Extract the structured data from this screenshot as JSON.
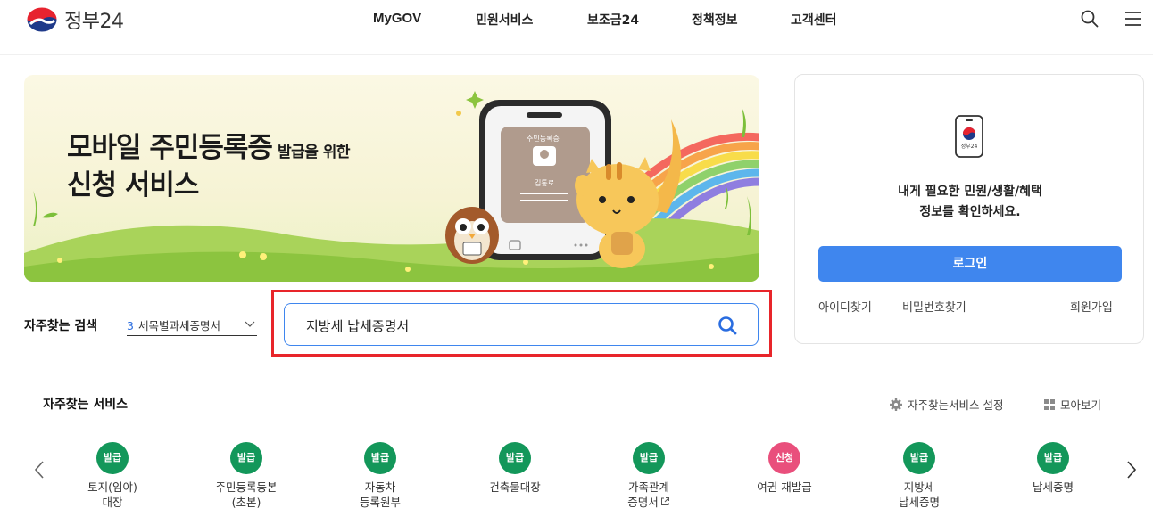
{
  "header": {
    "logo_text": "정부24",
    "nav": [
      "MyGOV",
      "민원서비스",
      "보조금24",
      "정책정보",
      "고객센터"
    ],
    "search_icon": "search-icon",
    "menu_icon": "hamburger-menu-icon"
  },
  "banner": {
    "title_main": "모바일 주민등록증",
    "title_small": "발급을 위한",
    "title_line2": "신청 서비스",
    "card_title": "주민등록증",
    "card_name": "김통로"
  },
  "login": {
    "icon_label": "정부24",
    "message_line1": "내게 필요한 민원/생활/혜택",
    "message_line2": "정보를 확인하세요.",
    "login_button": "로그인",
    "find_id": "아이디찾기",
    "find_password": "비밀번호찾기",
    "signup": "회원가입"
  },
  "frequent_search": {
    "label": "자주찾는 검색",
    "selected_rank": "3",
    "selected_term": "세목별과세증명서",
    "search_value": "지방세 납세증명서"
  },
  "services": {
    "title": "자주찾는 서비스",
    "settings_label": "자주찾는서비스 설정",
    "grid_label": "모아보기",
    "items": [
      {
        "badge": "발급",
        "line1": "토지(임야)",
        "line2": "대장",
        "badge_color": "#13975a"
      },
      {
        "badge": "발급",
        "line1": "주민등록등본",
        "line2": "(초본)",
        "badge_color": "#13975a"
      },
      {
        "badge": "발급",
        "line1": "자동차",
        "line2": "등록원부",
        "badge_color": "#13975a"
      },
      {
        "badge": "발급",
        "line1": "건축물대장",
        "line2": "",
        "badge_color": "#13975a"
      },
      {
        "badge": "발급",
        "line1": "가족관계",
        "line2": "증명서",
        "badge_color": "#13975a"
      },
      {
        "badge": "신청",
        "line1": "여권 재발급",
        "line2": "",
        "badge_color": "#e94f7c"
      },
      {
        "badge": "발급",
        "line1": "지방세",
        "line2": "납세증명",
        "badge_color": "#13975a"
      },
      {
        "badge": "발급",
        "line1": "납세증명",
        "line2": "",
        "badge_color": "#13975a"
      }
    ]
  },
  "colors": {
    "accent_blue": "#3f86ee",
    "highlight_red": "#e8252a",
    "badge_green": "#13975a",
    "badge_pink": "#e94f7c"
  }
}
